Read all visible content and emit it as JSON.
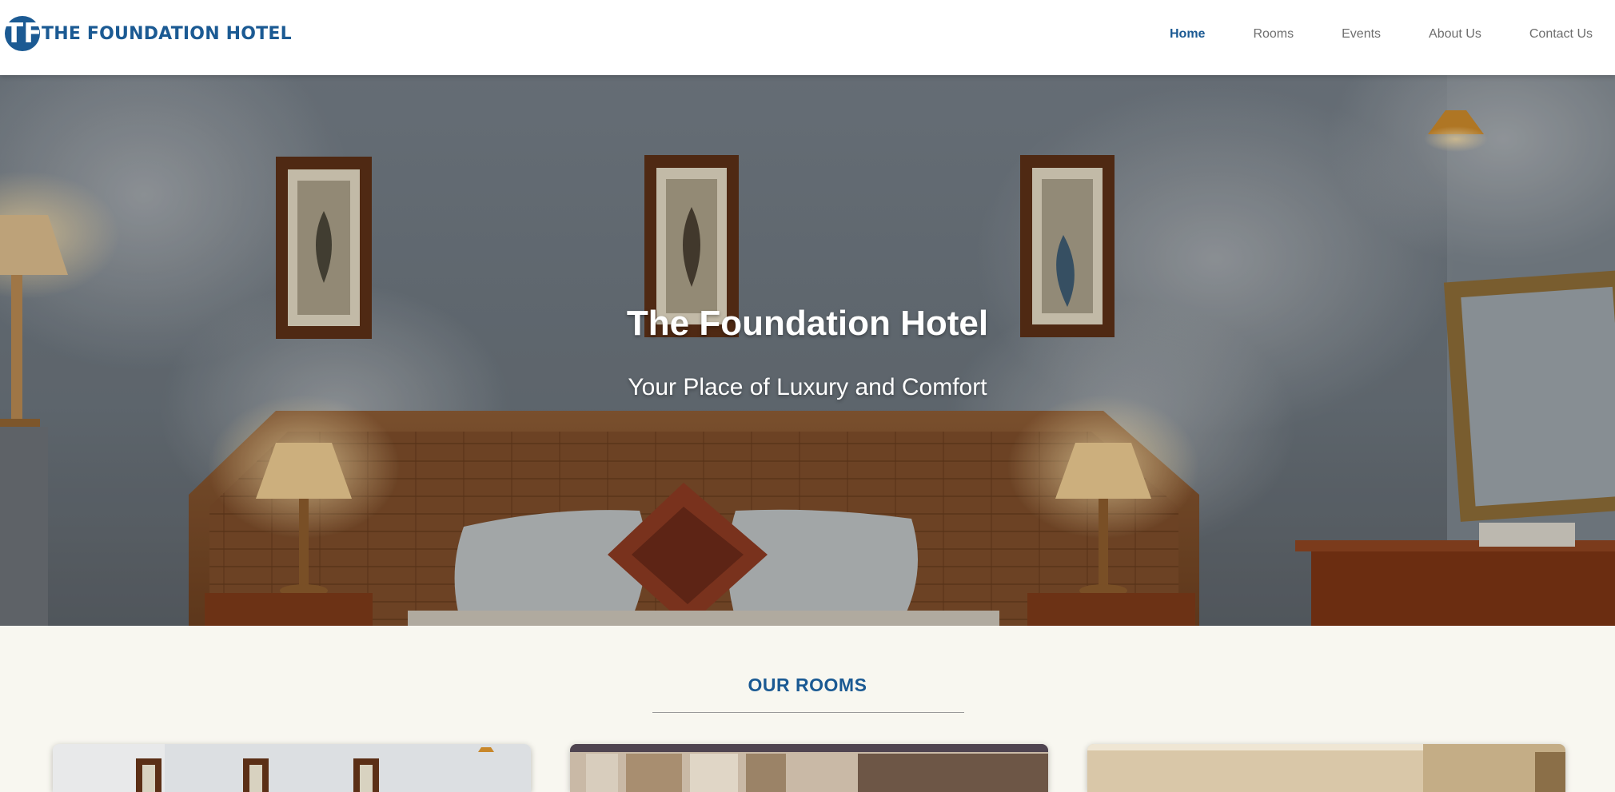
{
  "header": {
    "logo_mark": "TF",
    "logo_text": "THE FOUNDATION HOTEL",
    "nav": [
      {
        "label": "Home",
        "active": true
      },
      {
        "label": "Rooms",
        "active": false
      },
      {
        "label": "Events",
        "active": false
      },
      {
        "label": "About Us",
        "active": false
      },
      {
        "label": "Contact Us",
        "active": false
      }
    ]
  },
  "hero": {
    "title": "The Foundation Hotel",
    "subtitle": "Your Place of Luxury and Comfort"
  },
  "rooms": {
    "heading": "OUR ROOMS",
    "cards": [
      {
        "image": "hotel-room-photo-1"
      },
      {
        "image": "hotel-room-photo-2"
      },
      {
        "image": "hotel-room-photo-3"
      }
    ]
  },
  "colors": {
    "brand_blue": "#1b5a93",
    "nav_text": "#6e6e6e",
    "section_bg": "#f8f7f0"
  }
}
